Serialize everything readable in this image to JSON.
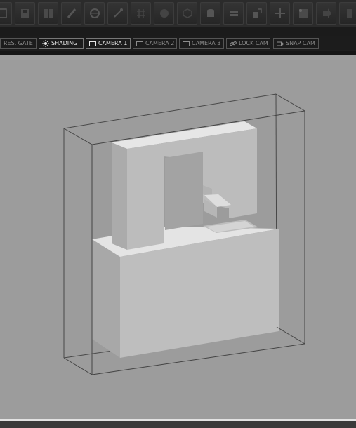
{
  "toolbar": {
    "buttons": [
      {
        "icon": "new-scene-icon"
      },
      {
        "icon": "save-icon"
      },
      {
        "icon": "split-view-icon"
      },
      {
        "icon": "brush-icon"
      },
      {
        "icon": "render-globe-icon"
      },
      {
        "icon": "wand-icon"
      },
      {
        "icon": "grid-icon"
      },
      {
        "icon": "sphere-icon"
      },
      {
        "icon": "cube-icon"
      },
      {
        "icon": "cylinder-icon"
      },
      {
        "icon": "layers-icon"
      },
      {
        "icon": "scale-icon"
      },
      {
        "icon": "move-icon"
      },
      {
        "icon": "edit-points-icon"
      },
      {
        "icon": "arrow-right-icon"
      },
      {
        "icon": "stack-icon"
      },
      {
        "icon": "bars-icon"
      }
    ]
  },
  "viewport_tabs": {
    "res_gate": "RES. GATE",
    "shading": "SHADING",
    "camera1": "CAMERA 1",
    "camera2": "CAMERA 2",
    "camera3": "CAMERA 3",
    "lock_cam": "LOCK CAM",
    "snap_cam": "SNAP CAM"
  },
  "colors": {
    "viewport_bg": "#9c9c9c",
    "face_light": "#e2e2e2",
    "face_mid": "#bcbcbc",
    "face_dark": "#aaaaaa",
    "wireframe": "#444444"
  }
}
